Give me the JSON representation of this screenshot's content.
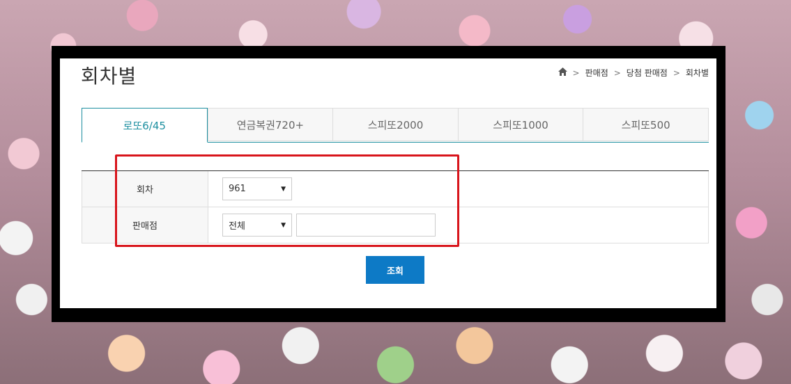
{
  "page": {
    "title": "회차별"
  },
  "breadcrumb": {
    "icon": "home-icon",
    "items": [
      "판매점",
      "당첨 판매점",
      "회차별"
    ]
  },
  "tabs": [
    {
      "label": "로또6/45",
      "active": true
    },
    {
      "label": "연금복권720+",
      "active": false
    },
    {
      "label": "스피또2000",
      "active": false
    },
    {
      "label": "스피또1000",
      "active": false
    },
    {
      "label": "스피또500",
      "active": false
    }
  ],
  "form": {
    "round": {
      "label": "회차",
      "value": "961"
    },
    "store": {
      "label": "판매점",
      "value": "전체",
      "input_value": ""
    }
  },
  "search_button": {
    "label": "조회"
  },
  "colors": {
    "accent": "#1d8fa0",
    "button": "#0d7ac6",
    "highlight": "#d8141b"
  }
}
